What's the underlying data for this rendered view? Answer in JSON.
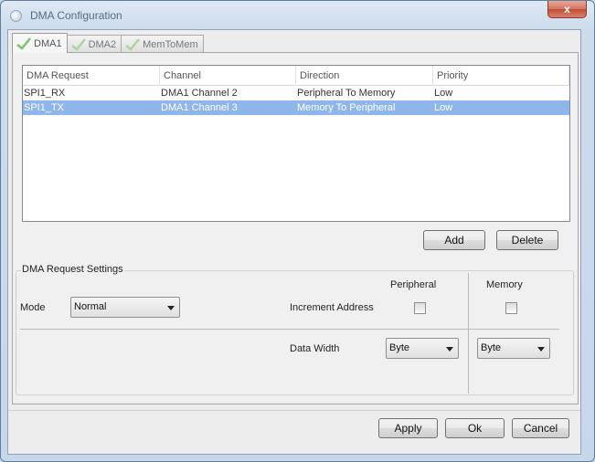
{
  "window": {
    "title": "DMA Configuration",
    "close_glyph": "x"
  },
  "tabs": [
    {
      "label": "DMA1",
      "icon": "check-icon",
      "active": true
    },
    {
      "label": "DMA2",
      "icon": "check-icon",
      "active": false
    },
    {
      "label": "MemToMem",
      "icon": "check-icon",
      "active": false
    }
  ],
  "table": {
    "columns": [
      "DMA Request",
      "Channel",
      "Direction",
      "Priority"
    ],
    "rows": [
      {
        "request": "SPI1_RX",
        "channel": "DMA1 Channel 2",
        "direction": "Peripheral To Memory",
        "priority": "Low",
        "selected": false
      },
      {
        "request": "SPI1_TX",
        "channel": "DMA1 Channel 3",
        "direction": "Memory To Peripheral",
        "priority": "Low",
        "selected": true
      }
    ]
  },
  "actions": {
    "add": "Add",
    "delete": "Delete"
  },
  "settings": {
    "title": "DMA Request Settings",
    "mode_label": "Mode",
    "mode_value": "Normal",
    "peripheral_header": "Peripheral",
    "memory_header": "Memory",
    "increment_label": "Increment Address",
    "peripheral_increment": false,
    "memory_increment": false,
    "data_width_label": "Data Width",
    "peripheral_width": "Byte",
    "memory_width": "Byte"
  },
  "footer": {
    "apply": "Apply",
    "ok": "Ok",
    "cancel": "Cancel"
  },
  "colors": {
    "selection": "#8fb6ea",
    "check": "#7cc26a"
  }
}
